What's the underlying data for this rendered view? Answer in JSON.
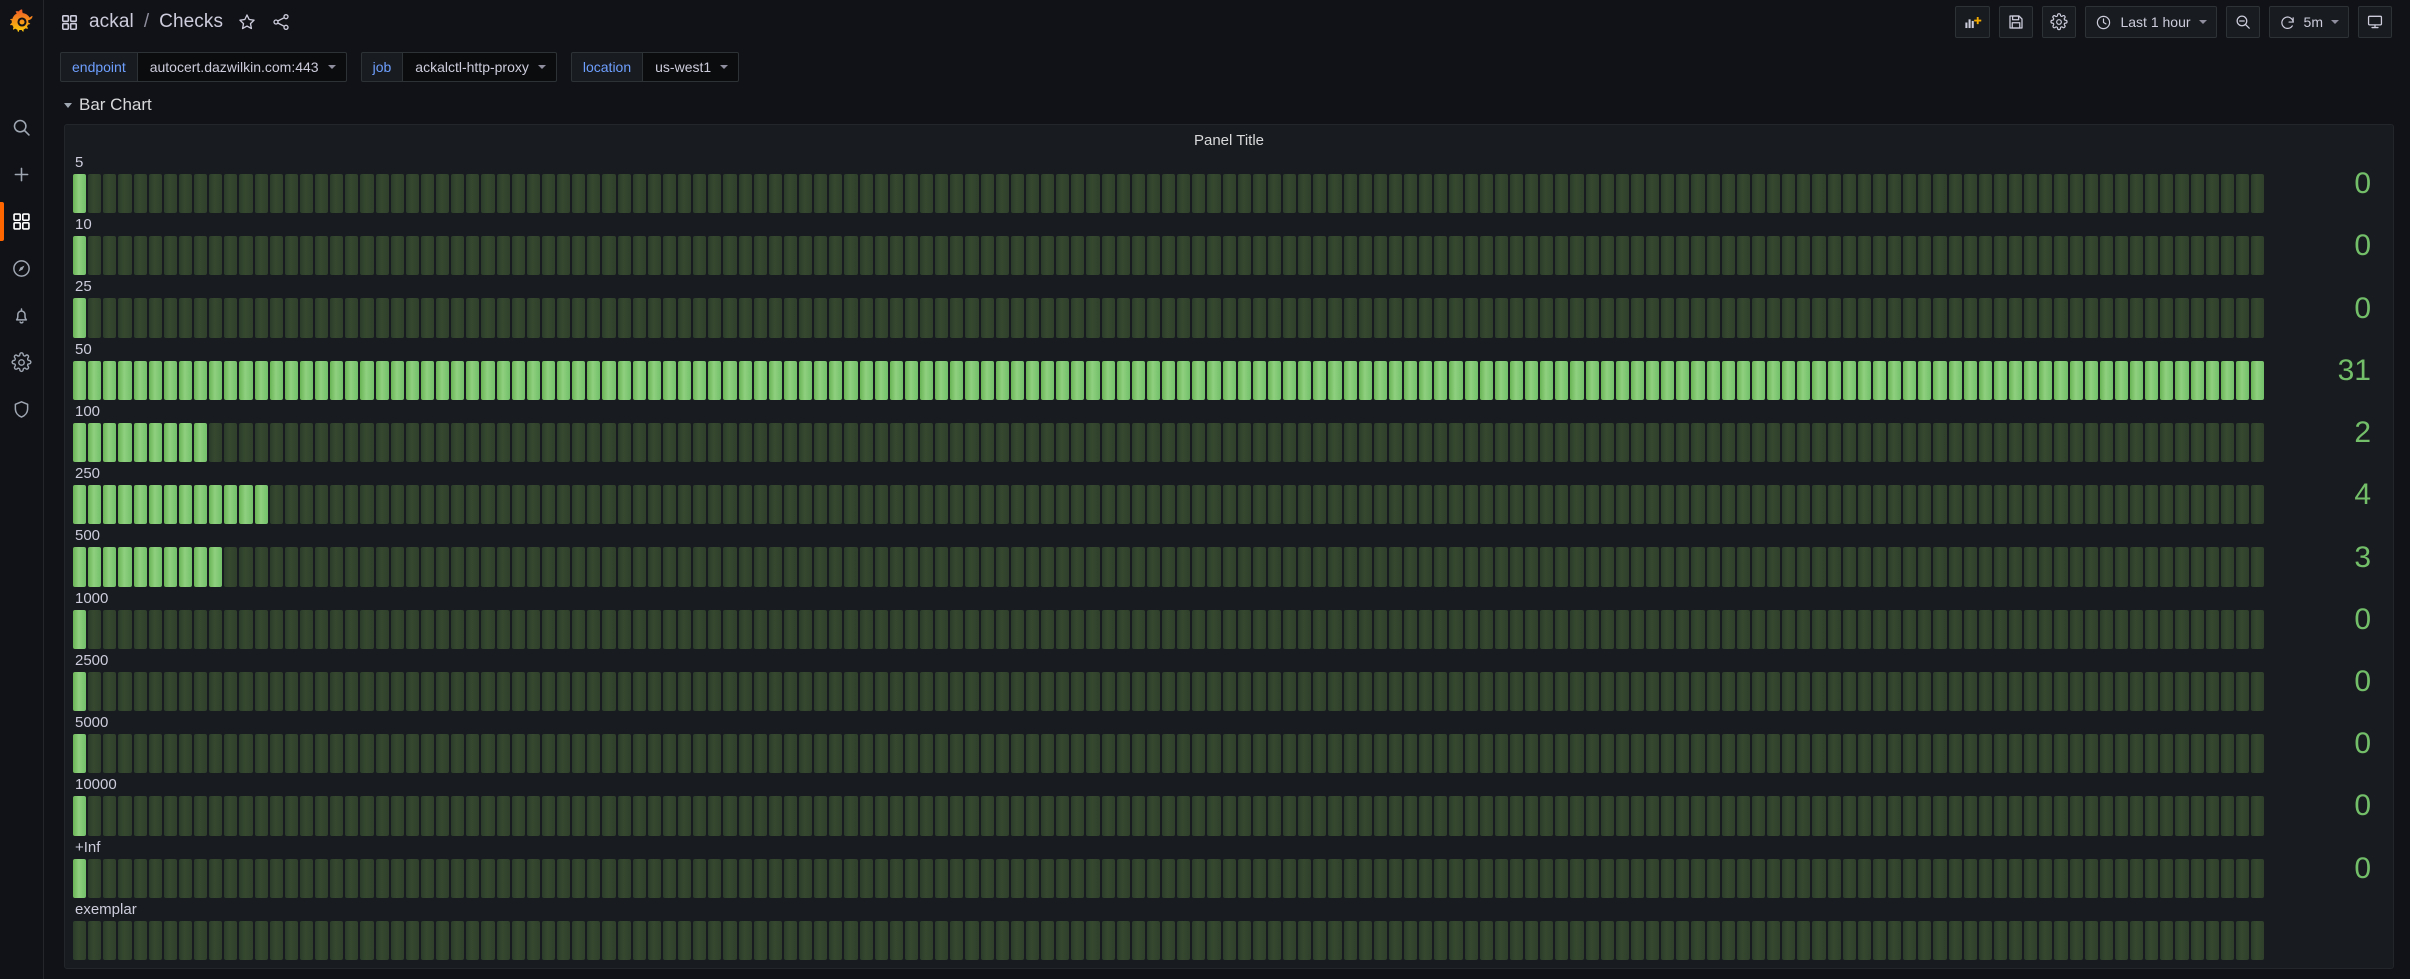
{
  "app": {
    "logo": "grafana-logo"
  },
  "sidebar": {
    "items": [
      {
        "name": "search",
        "icon": "search-icon",
        "active": false
      },
      {
        "name": "create",
        "icon": "plus-icon",
        "active": false
      },
      {
        "name": "dashboards",
        "icon": "dashboards-icon",
        "active": true
      },
      {
        "name": "explore",
        "icon": "compass-icon",
        "active": false
      },
      {
        "name": "alerting",
        "icon": "bell-icon",
        "active": false
      },
      {
        "name": "configuration",
        "icon": "gear-icon",
        "active": false
      },
      {
        "name": "admin",
        "icon": "shield-icon",
        "active": false
      }
    ]
  },
  "header": {
    "folder": "ackal",
    "separator": "/",
    "dashboard": "Checks",
    "star_icon": "star-icon",
    "share_icon": "share-icon",
    "dashboards_icon": "dashboards-icon"
  },
  "toolbar": {
    "add_panel_label": "add-panel",
    "save_label": "save-dashboard",
    "settings_label": "dashboard-settings",
    "time_range": "Last 1 hour",
    "zoom_out_label": "zoom-out-time-range",
    "refresh_label": "refresh-dashboard",
    "refresh_interval": "5m",
    "kiosk_label": "cycle-view-mode"
  },
  "variables": [
    {
      "key": "endpoint",
      "value": "autocert.dazwilkin.com:443"
    },
    {
      "key": "job",
      "value": "ackalctl-http-proxy"
    },
    {
      "key": "location",
      "value": "us-west1"
    }
  ],
  "row": {
    "title": "Bar Chart",
    "collapsed": false
  },
  "panel": {
    "title": "Panel Title"
  },
  "chart_data": {
    "type": "heatmap",
    "title": "Panel Title",
    "xlabel": "",
    "ylabel": "",
    "legend": "none",
    "grid": false,
    "buckets": 145,
    "colors": {
      "on": "#73bf69",
      "off": "#334a2d",
      "value_text": "#73bf69"
    },
    "series": [
      {
        "name": "5",
        "value": 0,
        "filled": 1,
        "values": [
          1
        ]
      },
      {
        "name": "10",
        "value": 0,
        "filled": 1,
        "values": [
          1
        ]
      },
      {
        "name": "25",
        "value": 0,
        "filled": 1,
        "values": [
          1
        ]
      },
      {
        "name": "50",
        "value": 31,
        "filled": 145,
        "values": [
          145
        ]
      },
      {
        "name": "100",
        "value": 2,
        "filled": 9,
        "values": [
          9
        ]
      },
      {
        "name": "250",
        "value": 4,
        "filled": 13,
        "values": [
          13
        ]
      },
      {
        "name": "500",
        "value": 3,
        "filled": 10,
        "values": [
          10
        ]
      },
      {
        "name": "1000",
        "value": 0,
        "filled": 1,
        "values": [
          1
        ]
      },
      {
        "name": "2500",
        "value": 0,
        "filled": 1,
        "values": [
          1
        ]
      },
      {
        "name": "5000",
        "value": 0,
        "filled": 1,
        "values": [
          1
        ]
      },
      {
        "name": "10000",
        "value": 0,
        "filled": 1,
        "values": [
          1
        ]
      },
      {
        "name": "+Inf",
        "value": 0,
        "filled": 1,
        "values": [
          1
        ]
      },
      {
        "name": "exemplar",
        "value": null,
        "filled": 0,
        "values": [
          0
        ]
      }
    ]
  }
}
